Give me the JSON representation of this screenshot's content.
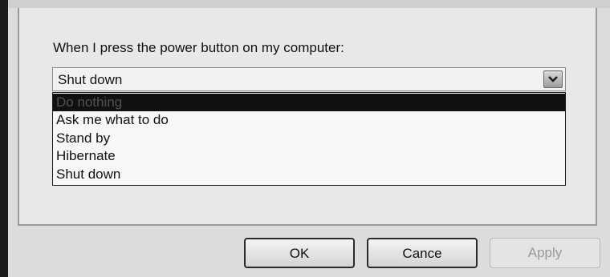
{
  "power_setting": {
    "label": "When I press the power button on my computer:",
    "selected_value": "Shut down",
    "options": [
      {
        "label": "Do nothing",
        "highlighted": true
      },
      {
        "label": "Ask me what to do",
        "highlighted": false
      },
      {
        "label": "Stand by",
        "highlighted": false
      },
      {
        "label": "Hibernate",
        "highlighted": false
      },
      {
        "label": "Shut down",
        "highlighted": false
      }
    ]
  },
  "buttons": {
    "ok": "OK",
    "cancel": "Cance",
    "apply": "Apply",
    "apply_enabled": false
  },
  "icons": {
    "dropdown_arrow": "chevron-down-icon"
  }
}
